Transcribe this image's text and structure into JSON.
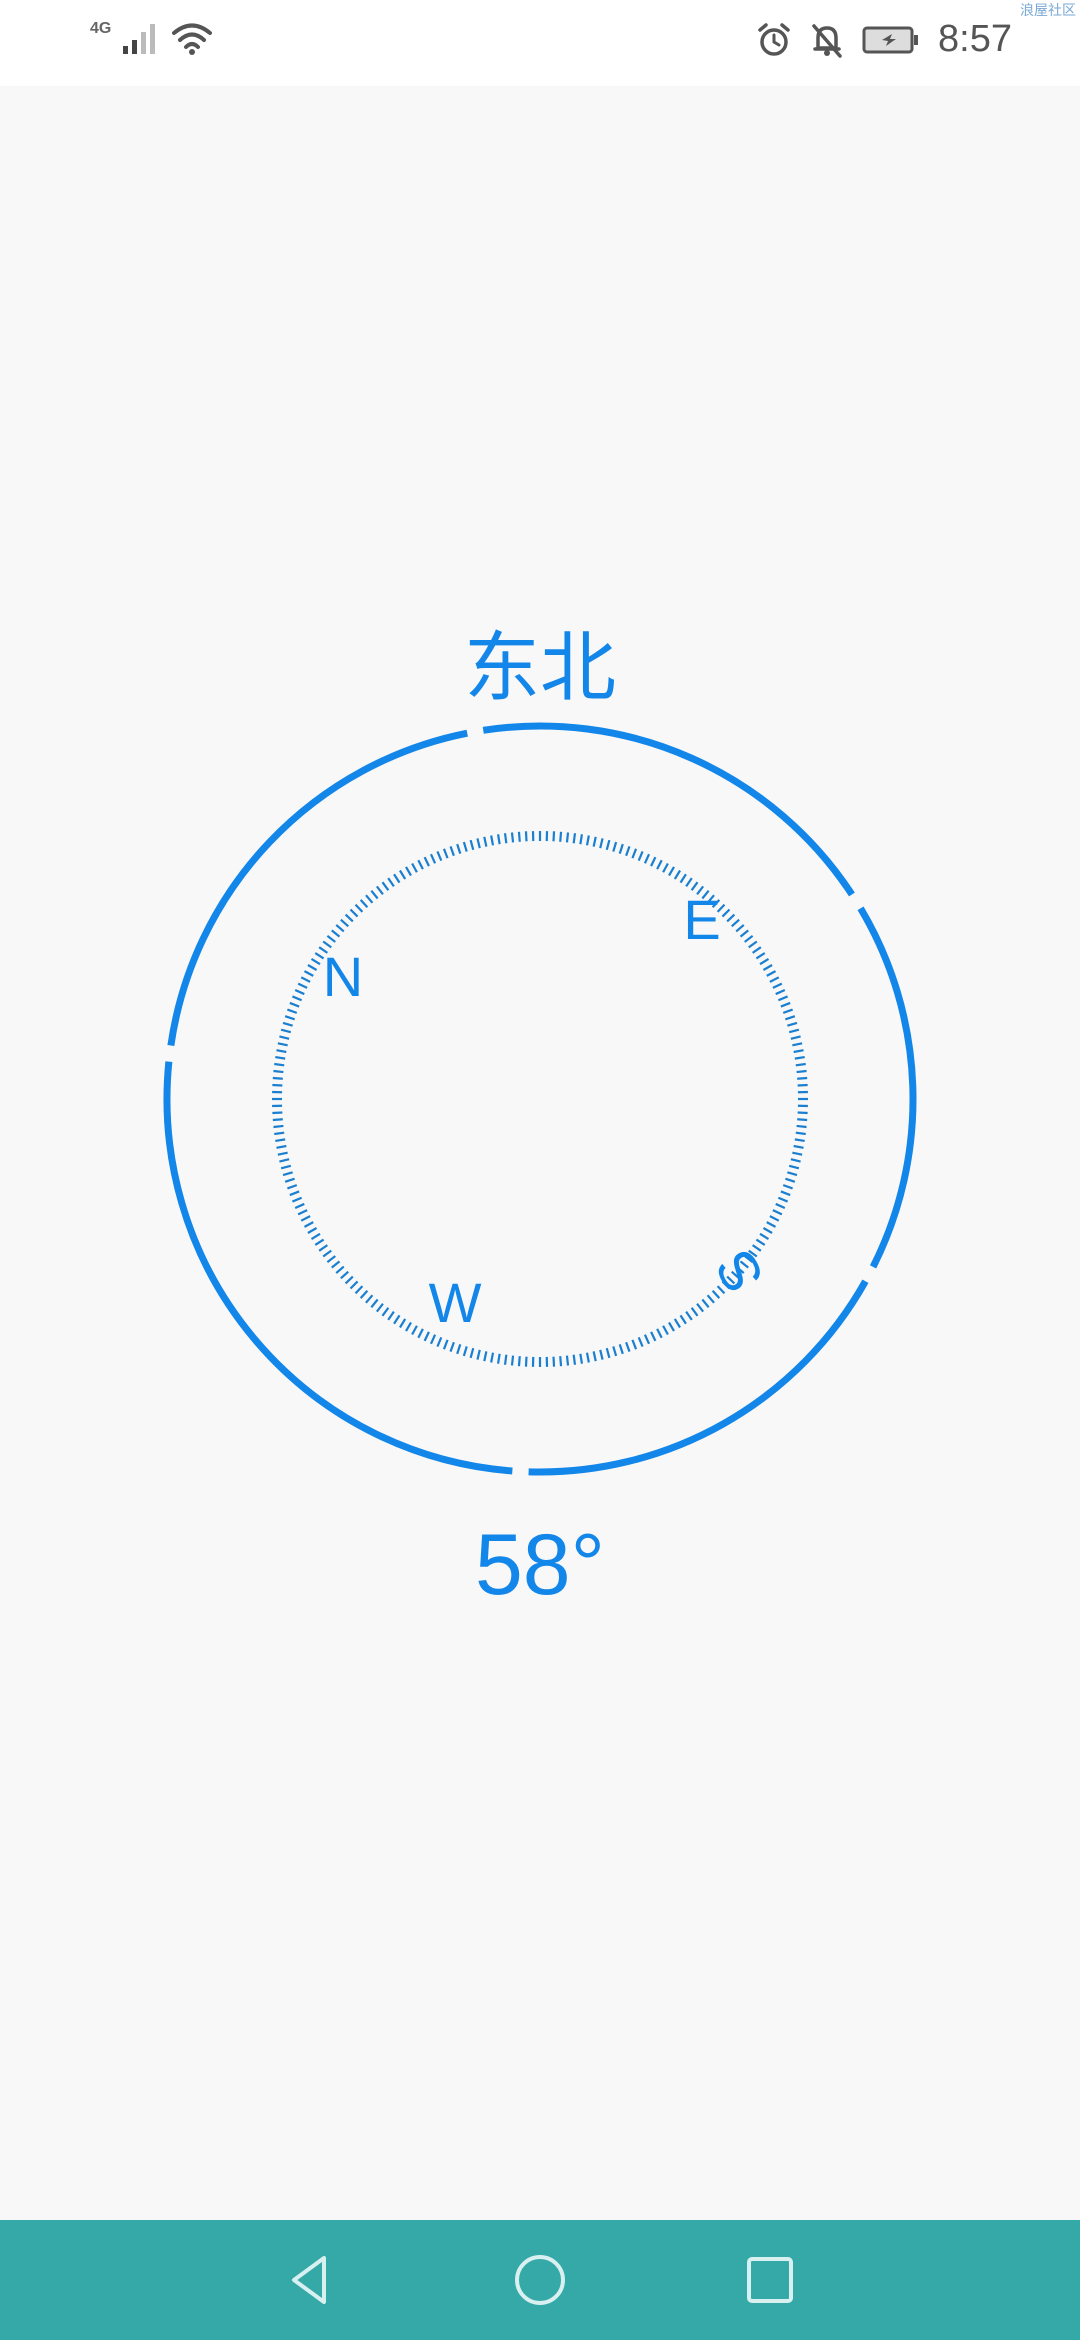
{
  "status_bar": {
    "network_type": "4G",
    "time": "8:57",
    "watermark": "浪屋社区",
    "icons": [
      "signal-icon",
      "wifi-icon",
      "alarm-icon",
      "notifications-off-icon",
      "battery-charging-icon"
    ]
  },
  "compass": {
    "direction": "东北",
    "degrees": "58°",
    "heading_value": 58,
    "labels": {
      "north": "N",
      "east": "E",
      "south": "S",
      "west": "W"
    },
    "accent_color": "#1386e9"
  },
  "nav_bar": {
    "buttons": [
      "back-icon",
      "home-icon",
      "recents-icon"
    ],
    "background": "#35a8a8"
  }
}
